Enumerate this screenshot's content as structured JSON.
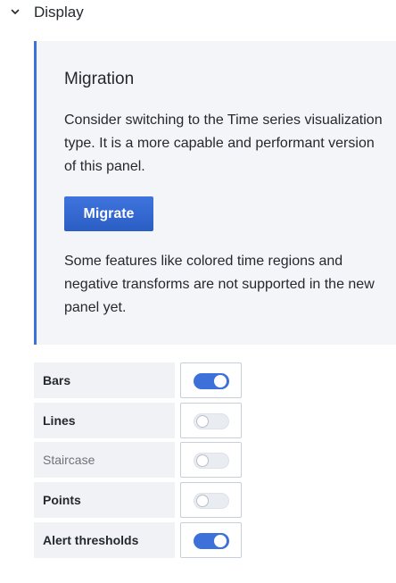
{
  "section": {
    "title": "Display",
    "icon": "chevron-down-icon"
  },
  "migration": {
    "title": "Migration",
    "text1": "Consider switching to the Time series visualization type. It is a more capable and performant version of this panel.",
    "button_label": "Migrate",
    "text2": "Some features like colored time regions and negative transforms are not supported in the new panel yet.",
    "accent_color": "#3d71d9"
  },
  "switches": [
    {
      "label": "Bars",
      "on": true
    },
    {
      "label": "Lines",
      "on": false
    },
    {
      "label": "Staircase",
      "on": false,
      "muted": true
    },
    {
      "label": "Points",
      "on": false
    },
    {
      "label": "Alert thresholds",
      "on": true
    }
  ]
}
